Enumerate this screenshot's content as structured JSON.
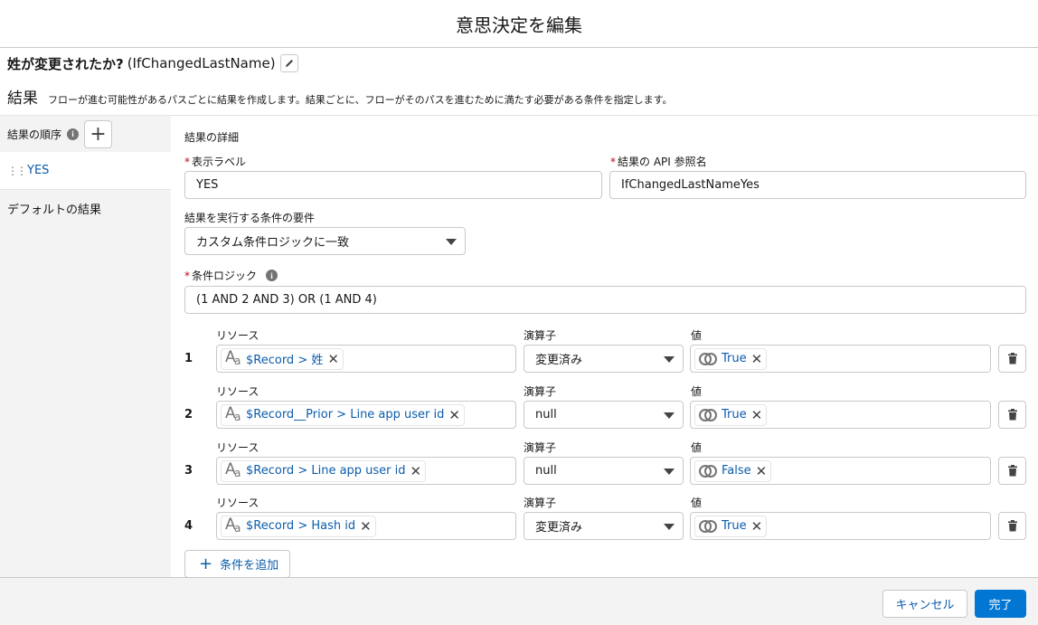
{
  "modal": {
    "title": "意思決定を編集"
  },
  "element": {
    "label": "姓が変更されたか?",
    "api_name": "(IfChangedLastName)"
  },
  "outcomes": {
    "heading": "結果",
    "description": "フローが進む可能性があるパスごとに結果を作成します。結果ごとに、フローがそのパスを進むために満たす必要がある条件を指定します。"
  },
  "sidebar": {
    "order_label": "結果の順序",
    "items": [
      {
        "label": "YES"
      },
      {
        "label": "デフォルトの結果"
      }
    ]
  },
  "details": {
    "title": "結果の詳細",
    "label_field": {
      "label": "表示ラベル",
      "value": "YES"
    },
    "api_field": {
      "label": "結果の API 参照名",
      "value": "IfChangedLastNameYes"
    },
    "requirement": {
      "label": "結果を実行する条件の要件",
      "value": "カスタム条件ロジックに一致"
    },
    "logic": {
      "label": "条件ロジック",
      "value": "(1 AND 2 AND 3) OR (1 AND 4)"
    }
  },
  "conditions": {
    "resource_label": "リソース",
    "operator_label": "演算子",
    "value_label": "値",
    "rows": [
      {
        "num": "1",
        "resource": "$Record > 姓",
        "operator": "変更済み",
        "value": "True"
      },
      {
        "num": "2",
        "resource": "$Record__Prior > Line app user id",
        "operator": "null",
        "value": "True"
      },
      {
        "num": "3",
        "resource": "$Record > Line app user id",
        "operator": "null",
        "value": "False"
      },
      {
        "num": "4",
        "resource": "$Record > Hash id",
        "operator": "変更済み",
        "value": "True"
      }
    ],
    "add_label": "条件を追加"
  },
  "footer": {
    "cancel": "キャンセル",
    "done": "完了"
  },
  "icons": {
    "edit": "pencil-icon",
    "info": "info-icon",
    "add": "plus-icon",
    "grip": "drag-handle-icon",
    "text_type": "text-type-icon",
    "boolean": "boolean-icon",
    "remove": "close-icon",
    "delete": "trash-icon"
  },
  "colors": {
    "link": "#0b5cab",
    "brand": "#0176d3",
    "required": "#ba0517"
  }
}
